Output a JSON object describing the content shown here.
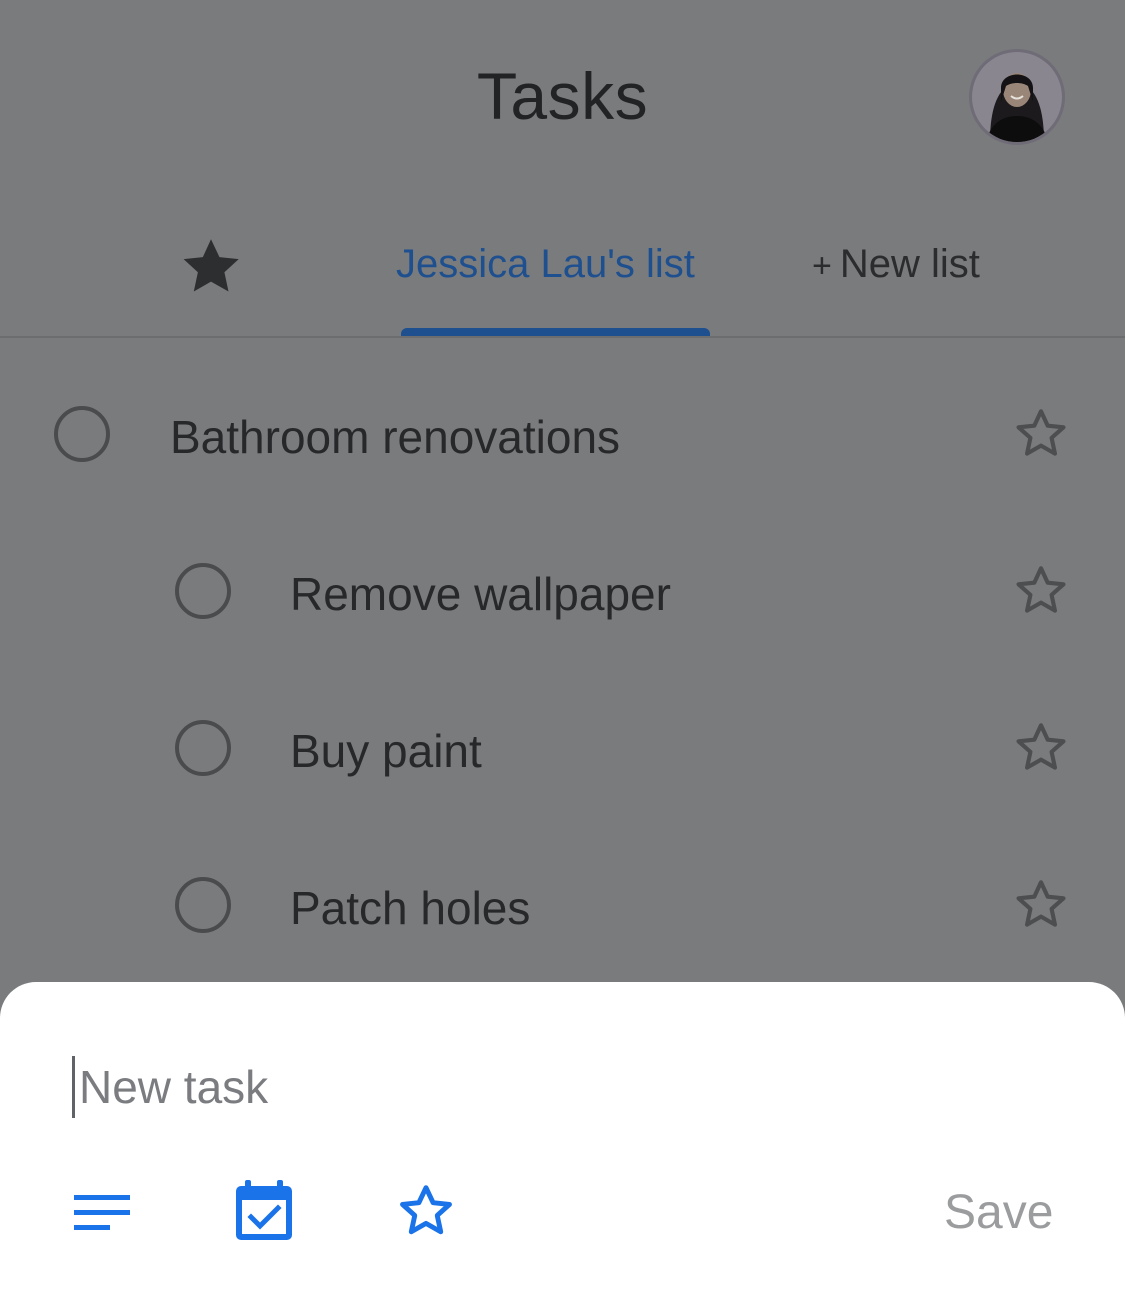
{
  "header": {
    "title": "Tasks"
  },
  "tabs": {
    "starred_icon": "star-filled-icon",
    "active_list": "Jessica Lau's list",
    "new_list_plus": "+",
    "new_list_label": "New list"
  },
  "tasks": [
    {
      "title": "Bathroom renovations",
      "subtask": false
    },
    {
      "title": "Remove wallpaper",
      "subtask": true
    },
    {
      "title": "Buy paint",
      "subtask": true
    },
    {
      "title": "Patch holes",
      "subtask": true
    }
  ],
  "sheet": {
    "input_placeholder": "New task",
    "input_value": "",
    "save_label": "Save",
    "icons": [
      "details-lines-icon",
      "calendar-check-icon",
      "star-outline-icon"
    ]
  },
  "colors": {
    "accent": "#1a73e8",
    "scrim": "#7a7b7d",
    "active_tab": "#1e4f8f"
  }
}
